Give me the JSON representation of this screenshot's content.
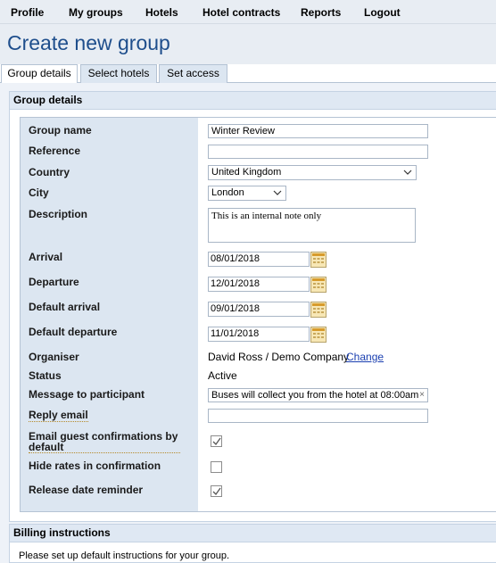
{
  "nav": {
    "items": [
      {
        "label": "Profile"
      },
      {
        "label": "My groups"
      },
      {
        "label": "Hotels"
      },
      {
        "label": "Hotel contracts"
      },
      {
        "label": "Reports"
      },
      {
        "label": "Logout"
      }
    ]
  },
  "page": {
    "title": "Create new group"
  },
  "tabs": [
    {
      "label": "Group details",
      "active": true
    },
    {
      "label": "Select hotels",
      "active": false
    },
    {
      "label": "Set access",
      "active": false
    }
  ],
  "group_details": {
    "header": "Group details",
    "fields": {
      "group_name": {
        "label": "Group name",
        "value": "Winter Review"
      },
      "reference": {
        "label": "Reference",
        "value": ""
      },
      "country": {
        "label": "Country",
        "value": "United Kingdom"
      },
      "city": {
        "label": "City",
        "value": "London"
      },
      "description": {
        "label": "Description",
        "value": "This is an internal note only"
      },
      "arrival": {
        "label": "Arrival",
        "value": "08/01/2018"
      },
      "departure": {
        "label": "Departure",
        "value": "12/01/2018"
      },
      "default_arrival": {
        "label": "Default arrival",
        "value": "09/01/2018"
      },
      "default_departure": {
        "label": "Default departure",
        "value": "11/01/2018"
      },
      "organiser": {
        "label": "Organiser",
        "value": "David Ross / Demo Company",
        "link": "Change"
      },
      "status": {
        "label": "Status",
        "value": "Active"
      },
      "message": {
        "label": "Message to participant",
        "value": "Buses will collect you from the hotel at 08:00am",
        "clear": "×"
      },
      "reply_email": {
        "label": "Reply email",
        "value": ""
      },
      "email_confirmations": {
        "label": "Email guest confirmations by default",
        "checked": true
      },
      "hide_rates": {
        "label": "Hide rates in confirmation",
        "checked": false
      },
      "release_reminder": {
        "label": "Release date reminder",
        "checked": true
      }
    }
  },
  "billing": {
    "header": "Billing instructions",
    "text": "Please set up default instructions for your group."
  },
  "colors": {
    "title": "#1e4e8c",
    "label_column": "#dce6f1",
    "section_header": "#dfe8f3",
    "link": "#1a3fb0"
  }
}
